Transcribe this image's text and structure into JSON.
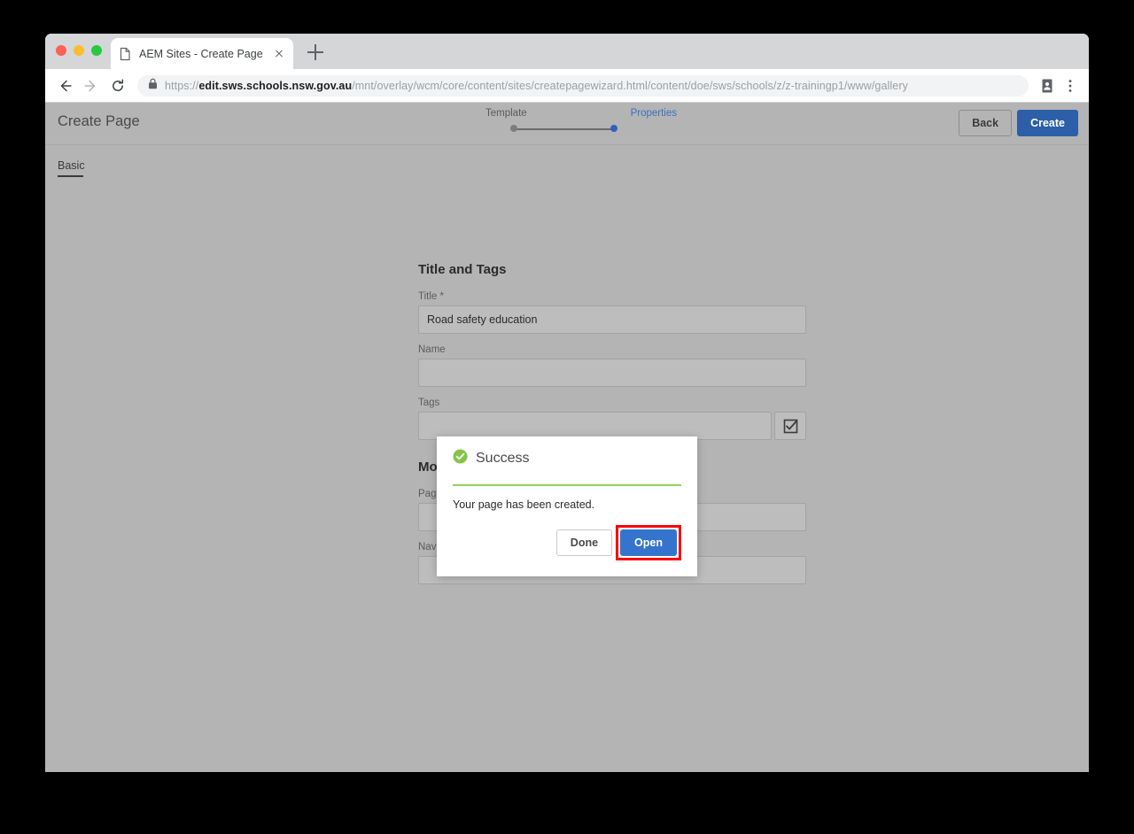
{
  "browser": {
    "tab": {
      "title": "AEM Sites - Create Page",
      "icon": "page-icon",
      "close_icon": "close-icon"
    },
    "new_tab_icon": "plus-icon",
    "nav": {
      "back_icon": "arrow-left-icon",
      "forward_icon": "arrow-right-icon",
      "reload_icon": "reload-icon"
    },
    "omnibox": {
      "lock_icon": "lock-icon",
      "scheme": "https://",
      "domain": "edit.sws.schools.nsw.gov.au",
      "path": "/mnt/overlay/wcm/core/content/sites/createpagewizard.html/content/doe/sws/schools/z/z-trainingp1/www/gallery",
      "full_url": "https://edit.sws.schools.nsw.gov.au/mnt/overlay/wcm/core/content/sites/createpagewizard.html/content/doe/sws/schools/z/z-trainingp1/www/gallery"
    },
    "toolbar_right": {
      "profile_icon": "contact-card-icon",
      "menu_icon": "three-dot-menu-icon"
    }
  },
  "app": {
    "title": "Create Page",
    "wizard": {
      "steps": [
        {
          "label": "Template",
          "state": "inactive"
        },
        {
          "label": "Properties",
          "state": "active"
        }
      ]
    },
    "actions": {
      "back_label": "Back",
      "create_label": "Create"
    },
    "tabs": [
      {
        "label": "Basic",
        "selected": true
      }
    ]
  },
  "form": {
    "sections": [
      {
        "heading": "Title and Tags",
        "fields": [
          {
            "label": "Title *",
            "value": "Road safety education",
            "placeholder": ""
          },
          {
            "label": "Name",
            "value": "",
            "placeholder": ""
          },
          {
            "label": "Tags",
            "value": "",
            "placeholder": "",
            "picker_icon": "checkbox-checked-icon"
          }
        ]
      },
      {
        "heading": "More Title",
        "fields": [
          {
            "label": "Page Title",
            "value": "",
            "placeholder": ""
          },
          {
            "label": "Navigation Title",
            "value": "",
            "placeholder": ""
          }
        ]
      }
    ]
  },
  "dialog": {
    "icon": "success-check-icon",
    "title": "Success",
    "message": "Your page has been created.",
    "buttons": {
      "done_label": "Done",
      "open_label": "Open"
    },
    "highlight": {
      "target": "open-button",
      "color": "#fb0007"
    }
  },
  "colors": {
    "accent_blue": "#2c5fa8",
    "dialog_blue": "#3574cd",
    "success_green": "#93d15b",
    "step_active": "#3a6fc4",
    "page_overlay": "#b4b4b4",
    "highlight_red": "#fb0007"
  }
}
